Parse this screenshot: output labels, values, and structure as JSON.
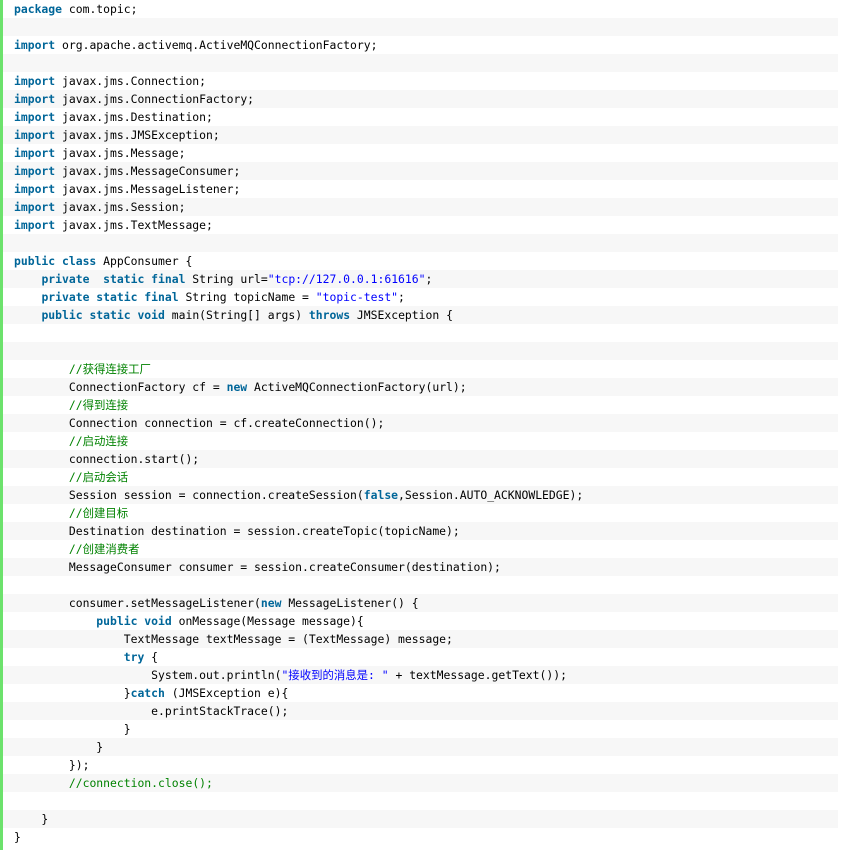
{
  "code_block": {
    "accent_color": "#6ce26c",
    "keyword_color": "#006699",
    "string_color": "#0000ff",
    "comment_color": "#008200",
    "lines": [
      [
        [
          "kw",
          "package"
        ],
        [
          "pl",
          " com.topic;"
        ]
      ],
      [],
      [
        [
          "kw",
          "import"
        ],
        [
          "pl",
          " org.apache.activemq.ActiveMQConnectionFactory;"
        ]
      ],
      [],
      [
        [
          "kw",
          "import"
        ],
        [
          "pl",
          " javax.jms.Connection;"
        ]
      ],
      [
        [
          "kw",
          "import"
        ],
        [
          "pl",
          " javax.jms.ConnectionFactory;"
        ]
      ],
      [
        [
          "kw",
          "import"
        ],
        [
          "pl",
          " javax.jms.Destination;"
        ]
      ],
      [
        [
          "kw",
          "import"
        ],
        [
          "pl",
          " javax.jms.JMSException;"
        ]
      ],
      [
        [
          "kw",
          "import"
        ],
        [
          "pl",
          " javax.jms.Message;"
        ]
      ],
      [
        [
          "kw",
          "import"
        ],
        [
          "pl",
          " javax.jms.MessageConsumer;"
        ]
      ],
      [
        [
          "kw",
          "import"
        ],
        [
          "pl",
          " javax.jms.MessageListener;"
        ]
      ],
      [
        [
          "kw",
          "import"
        ],
        [
          "pl",
          " javax.jms.Session;"
        ]
      ],
      [
        [
          "kw",
          "import"
        ],
        [
          "pl",
          " javax.jms.TextMessage;"
        ]
      ],
      [],
      [
        [
          "kw",
          "public class"
        ],
        [
          "pl",
          " AppConsumer {"
        ]
      ],
      [
        [
          "pl",
          "    "
        ],
        [
          "kw",
          "private  static final"
        ],
        [
          "pl",
          " String url="
        ],
        [
          "str",
          "\"tcp://127.0.0.1:61616\""
        ],
        [
          "pl",
          ";"
        ]
      ],
      [
        [
          "pl",
          "    "
        ],
        [
          "kw",
          "private static final"
        ],
        [
          "pl",
          " String topicName = "
        ],
        [
          "str",
          "\"topic-test\""
        ],
        [
          "pl",
          ";"
        ]
      ],
      [
        [
          "pl",
          "    "
        ],
        [
          "kw",
          "public static void"
        ],
        [
          "pl",
          " main(String[] args) "
        ],
        [
          "kw",
          "throws"
        ],
        [
          "pl",
          " JMSException {"
        ]
      ],
      [],
      [],
      [
        [
          "pl",
          "        "
        ],
        [
          "cmt",
          "//获得连接工厂"
        ]
      ],
      [
        [
          "pl",
          "        ConnectionFactory cf = "
        ],
        [
          "kw",
          "new"
        ],
        [
          "pl",
          " ActiveMQConnectionFactory(url);"
        ]
      ],
      [
        [
          "pl",
          "        "
        ],
        [
          "cmt",
          "//得到连接"
        ]
      ],
      [
        [
          "pl",
          "        Connection connection = cf.createConnection();"
        ]
      ],
      [
        [
          "pl",
          "        "
        ],
        [
          "cmt",
          "//启动连接"
        ]
      ],
      [
        [
          "pl",
          "        connection.start();"
        ]
      ],
      [
        [
          "pl",
          "        "
        ],
        [
          "cmt",
          "//启动会话"
        ]
      ],
      [
        [
          "pl",
          "        Session session = connection.createSession("
        ],
        [
          "kw",
          "false"
        ],
        [
          "pl",
          ",Session.AUTO_ACKNOWLEDGE);"
        ]
      ],
      [
        [
          "pl",
          "        "
        ],
        [
          "cmt",
          "//创建目标"
        ]
      ],
      [
        [
          "pl",
          "        Destination destination = session.createTopic(topicName);"
        ]
      ],
      [
        [
          "pl",
          "        "
        ],
        [
          "cmt",
          "//创建消费者"
        ]
      ],
      [
        [
          "pl",
          "        MessageConsumer consumer = session.createConsumer(destination);"
        ]
      ],
      [],
      [
        [
          "pl",
          "        consumer.setMessageListener("
        ],
        [
          "kw",
          "new"
        ],
        [
          "pl",
          " MessageListener() {"
        ]
      ],
      [
        [
          "pl",
          "            "
        ],
        [
          "kw",
          "public void"
        ],
        [
          "pl",
          " onMessage(Message message){"
        ]
      ],
      [
        [
          "pl",
          "                TextMessage textMessage = (TextMessage) message;"
        ]
      ],
      [
        [
          "pl",
          "                "
        ],
        [
          "kw",
          "try"
        ],
        [
          "pl",
          " {"
        ]
      ],
      [
        [
          "pl",
          "                    System.out.println("
        ],
        [
          "str",
          "\"接收到的消息是: \""
        ],
        [
          "pl",
          " + textMessage.getText());"
        ]
      ],
      [
        [
          "pl",
          "                }"
        ],
        [
          "kw",
          "catch"
        ],
        [
          "pl",
          " (JMSException e){"
        ]
      ],
      [
        [
          "pl",
          "                    e.printStackTrace();"
        ]
      ],
      [
        [
          "pl",
          "                }"
        ]
      ],
      [
        [
          "pl",
          "            }"
        ]
      ],
      [
        [
          "pl",
          "        });"
        ]
      ],
      [
        [
          "pl",
          "        "
        ],
        [
          "cmt",
          "//connection.close();"
        ]
      ],
      [],
      [
        [
          "pl",
          "    }"
        ]
      ],
      [
        [
          "pl",
          "}"
        ]
      ]
    ]
  }
}
